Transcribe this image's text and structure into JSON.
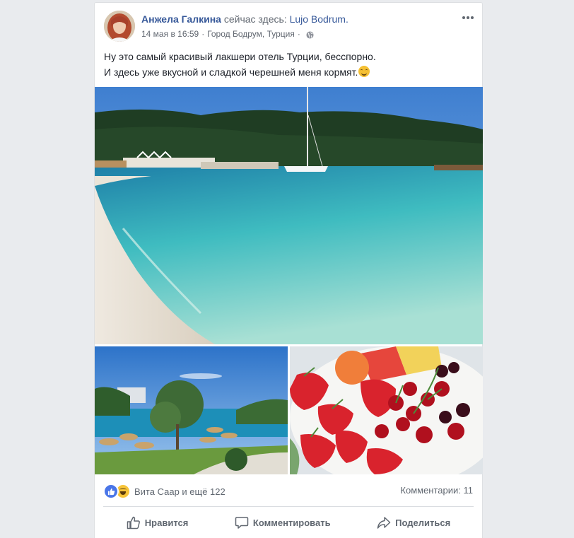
{
  "post": {
    "author": "Анжела Галкина",
    "checkin_text": "сейчас здесь:",
    "place": "Lujo Bodrum.",
    "date": "14 мая в 16:59",
    "location": "Город Бодрум, Турция",
    "privacy_icon": "globe-icon",
    "menu_icon": "more-options-icon",
    "text_line1": "Ну это самый красивый лакшери отель Турции, бесспорно.",
    "text_line2": "И здесь уже вкусной и сладкой черешней меня кормят."
  },
  "reactions": {
    "icons": [
      "like-reaction-icon",
      "haha-reaction-icon"
    ],
    "summary": "Вита Саар и ещё 122",
    "comments": "Комментарии: 11"
  },
  "actions": {
    "like": "Нравится",
    "comment": "Комментировать",
    "share": "Поделиться"
  },
  "colors": {
    "link": "#365899",
    "secondary_text": "#606770",
    "background": "#e9ebee",
    "like_blue": "#4a76e8"
  }
}
